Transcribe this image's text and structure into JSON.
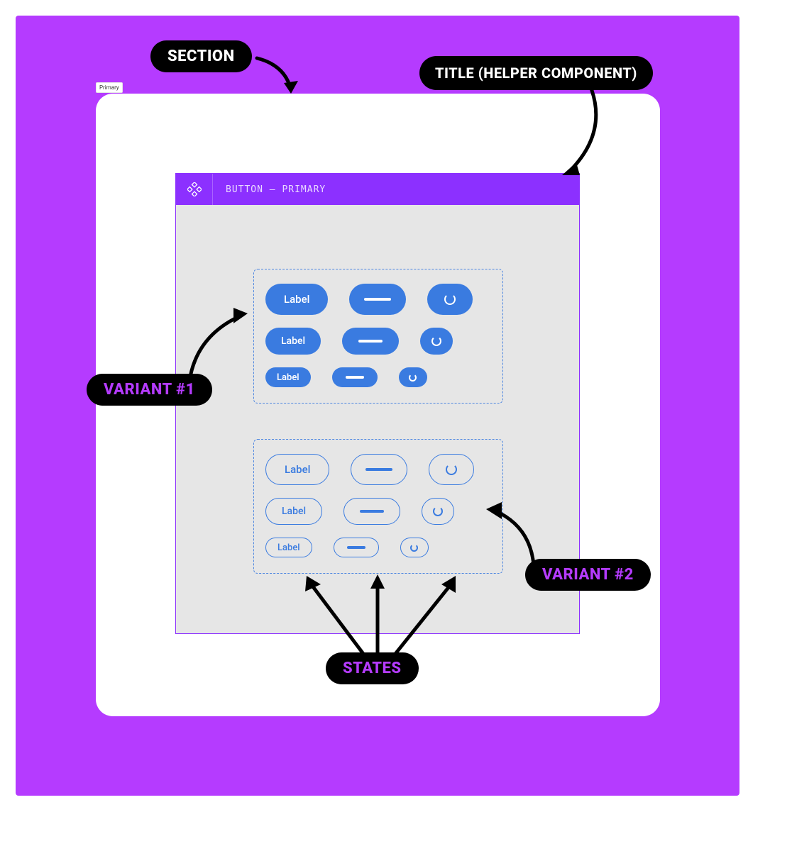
{
  "frame_tag": "Primary",
  "component": {
    "header_title": "BUTTON — PRIMARY"
  },
  "button_label": "Label",
  "annotations": {
    "section": "SECTION",
    "title": "TITLE (HELPER COMPONENT)",
    "variant1": "VARIANT #1",
    "variant2": "VARIANT #2",
    "states": "STATES"
  },
  "colors": {
    "canvas": "#b53bff",
    "accent": "#8c30ff",
    "button_primary": "#3a7be0"
  }
}
